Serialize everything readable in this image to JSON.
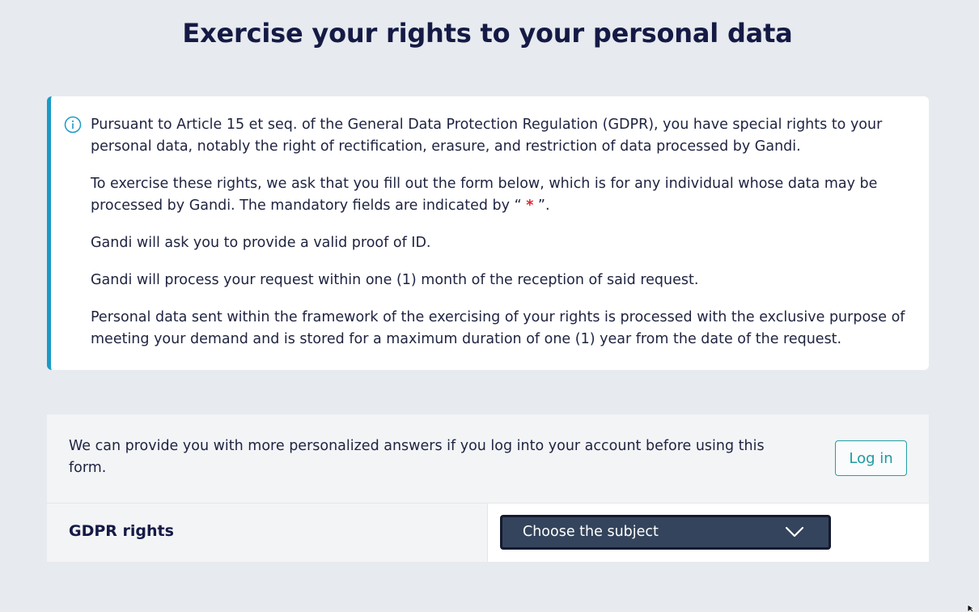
{
  "page": {
    "title": "Exercise your rights to your personal data"
  },
  "info": {
    "icon": "info-icon",
    "paragraph_1": "Pursuant to Article 15 et seq. of the General Data Protection Regulation (GDPR), you have special rights to your personal data, notably the right of rectification, erasure, and restriction of data processed by Gandi.",
    "paragraph_2_before": "To exercise these rights, we ask that you fill out the form below, which is for any individual whose data may be processed by Gandi. The mandatory fields are indicated by “ ",
    "paragraph_2_star": "*",
    "paragraph_2_after": " ”.",
    "paragraph_3": "Gandi will ask you to provide a valid proof of ID.",
    "paragraph_4": "Gandi will process your request within one (1) month of the reception of said request.",
    "paragraph_5": "Personal data sent within the framework of the exercising of your rights is processed with the exclusive purpose of meeting your demand and is stored for a maximum duration of one (1) year from the date of the request."
  },
  "login": {
    "message": "We can provide you with more personalized answers if you log into your account before using this form.",
    "button_label": "Log in"
  },
  "form": {
    "gdpr_label": "GDPR rights",
    "subject_select_value": "Choose the subject",
    "subject_select_icon": "chevron-down-icon"
  },
  "colors": {
    "accent": "#1a9bc8",
    "login_button": "#1e9aa0",
    "select_background": "#34445c",
    "required_star": "#e0242f"
  }
}
